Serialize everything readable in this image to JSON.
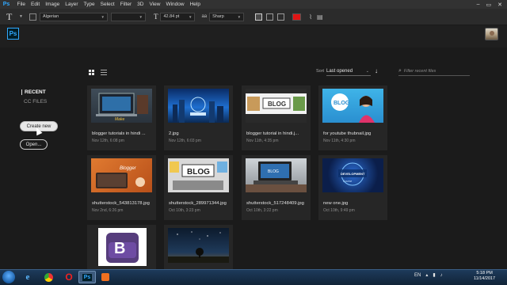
{
  "menubar": {
    "logo": "Ps",
    "items": [
      "File",
      "Edit",
      "Image",
      "Layer",
      "Type",
      "Select",
      "Filter",
      "3D",
      "View",
      "Window",
      "Help"
    ]
  },
  "options": {
    "font_family": "Algerian",
    "font_style": "",
    "font_size": "42.84 pt",
    "antialias_label": "aa",
    "antialias": "Sharp",
    "text_color": "#e01414"
  },
  "home": {
    "nav": {
      "recent": "RECENT",
      "cc_files": "CC FILES"
    },
    "buttons": {
      "create_new": "Create new",
      "open": "Open..."
    },
    "sort": {
      "label": "Sort",
      "value": "Last opened"
    },
    "filter": {
      "placeholder": "Filter recent files"
    }
  },
  "files": [
    {
      "name": "blogger tutorials in hindi ...",
      "date": "Nov 12th, 6:08 pm",
      "thumb": "laptop-blogger"
    },
    {
      "name": "2.jpg",
      "date": "Nov 12th, 6:03 pm",
      "thumb": "city-blue"
    },
    {
      "name": "blogger tutorial in hindi.j...",
      "date": "Nov 11th, 4:35 pm",
      "thumb": "blog-white"
    },
    {
      "name": "for youtube thubnail.jpg",
      "date": "Nov 11th, 4:30 pm",
      "thumb": "girl-blog"
    },
    {
      "name": "shutterstock_543813178.jpg",
      "date": "Nov 2nd, 6:26 pm",
      "thumb": "blogger-orange"
    },
    {
      "name": "shutterstock_289971344.jpg",
      "date": "Oct 10th, 3:23 pm",
      "thumb": "blog-keys"
    },
    {
      "name": "shutterstock_517248409.jpg",
      "date": "Oct 10th, 3:22 pm",
      "thumb": "laptop-desk"
    },
    {
      "name": "new one.jpg",
      "date": "Oct 10th, 9:49 pm",
      "thumb": "web-dev"
    },
    {
      "name": "",
      "date": "",
      "thumb": "bootstrap"
    },
    {
      "name": "",
      "date": "",
      "thumb": "night-tree"
    }
  ],
  "taskbar": {
    "lang": "EN",
    "time": "5:18 PM",
    "date": "11/14/2017"
  }
}
